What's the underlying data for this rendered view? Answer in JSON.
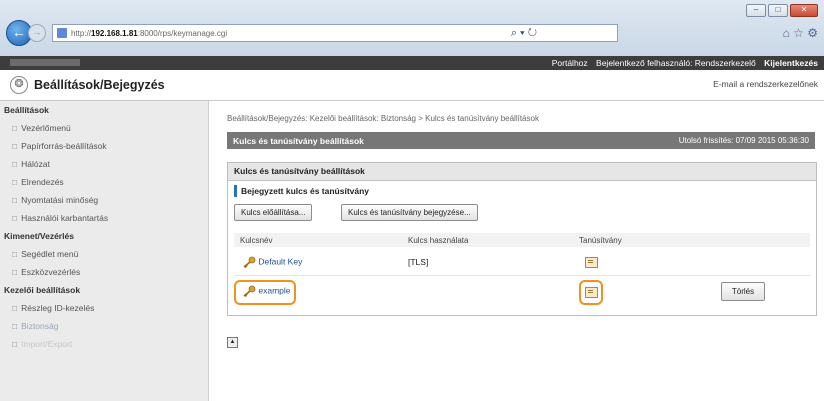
{
  "browser": {
    "url_prefix": "http://",
    "url_host": "192.168.1.81",
    "url_rest": ":8000/rps/keymanage.cgi",
    "search_icons": "⌕ ▾ ↻",
    "nav_icons": "⌂ ☆ ⚙",
    "min": "–",
    "max": "□",
    "close": "✕",
    "back": "←",
    "forward": "→"
  },
  "darkbar": {
    "portal": "Portálhoz",
    "login_user": "Bejelentkező felhasználó: Rendszerkezelő",
    "logout": "Kijelentkezés"
  },
  "title": {
    "icon": "❂",
    "text": "Beállítások/Bejegyzés",
    "email": "E-mail a rendszerkezelőnek"
  },
  "sidebar": {
    "sections": [
      {
        "label": "Beállítások",
        "items": [
          "Vezérlőmenü",
          "Papírforrás-beállítások",
          "Hálózat",
          "Elrendezés",
          "Nyomtatási minőség",
          "Használói karbantartás"
        ]
      },
      {
        "label": "Kimenet/Vezérlés",
        "items": [
          "Segédlet menü",
          "Eszközvezérlés"
        ]
      },
      {
        "label": "Kezelői beállítások",
        "items": [
          "Részleg ID-kezelés",
          "Biztonság",
          "Import/Export"
        ]
      }
    ],
    "bullet": "□"
  },
  "main": {
    "breadcrumb": "Beállítások/Bejegyzés: Kezelői beállítások: Biztonság > Kulcs és tanúsítvány beállítások",
    "header": "Kulcs és tanúsítvány beállítások",
    "updated": "Utolsó frissítés: 07/09 2015 05:36:30",
    "panel_title": "Kulcs és tanúsítvány beállítások",
    "sub_title": "Bejegyzett kulcs és tanúsítvány",
    "btn_generate": "Kulcs előállítása...",
    "btn_register": "Kulcs és tanúsítvány bejegyzése...",
    "columns": [
      "Kulcsnév",
      "Kulcs használata",
      "Tanúsítvány"
    ],
    "rows": [
      {
        "name": "Default Key",
        "usage": "[TLS]",
        "delete": ""
      },
      {
        "name": "example",
        "usage": "",
        "delete": "Törlés"
      }
    ],
    "top_icon": "▲"
  }
}
